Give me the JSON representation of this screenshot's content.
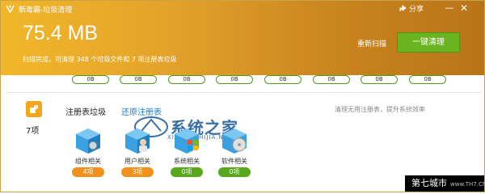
{
  "window": {
    "title": "新毒霸-垃圾清理",
    "share_label": "分享",
    "minimize_label": "—",
    "close_label": "✕"
  },
  "summary": {
    "size_value": "75.4 MB",
    "scan_text": "扫描完成，可清理 348 个垃圾文件和 7 项注册表垃圾"
  },
  "actions": {
    "rescan_label": "重新扫描",
    "clean_label": "一键清理"
  },
  "size_pills": [
    "0B",
    "0B",
    "0B",
    "0B",
    "0B",
    "0B",
    "0B",
    "0B"
  ],
  "category": {
    "count_label": "7项",
    "tab_registry": "注册表垃圾",
    "tab_restore": "还原注册表",
    "description": "清理无用注册表，提升系统效率"
  },
  "watermark": {
    "text": "系统之家",
    "sub": "XITONGZHIJIA.NET"
  },
  "items": [
    {
      "label": "组件相关",
      "count": "4项",
      "status": "orange",
      "icon": "component-cube-icon"
    },
    {
      "label": "用户相关",
      "count": "3项",
      "status": "orange",
      "icon": "user-cube-icon"
    },
    {
      "label": "系统相关",
      "count": "0项",
      "status": "green",
      "icon": "windows-system-icon"
    },
    {
      "label": "软件相关",
      "count": "0项",
      "status": "green",
      "icon": "software-disc-icon"
    }
  ],
  "corner_mark": {
    "text": "第七城市",
    "url": "www.TH7.CN"
  },
  "colors": {
    "header_start": "#f2b72a",
    "header_end": "#b87418",
    "clean_button": "#69b41f",
    "link_blue": "#1a7fd0",
    "badge_orange": "#f0911d",
    "badge_green": "#58a71c"
  }
}
